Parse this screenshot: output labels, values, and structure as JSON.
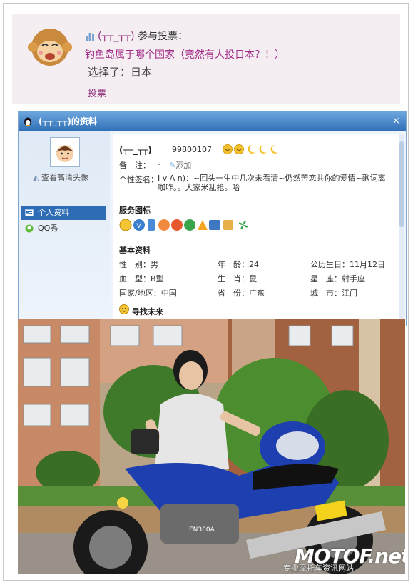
{
  "vote": {
    "nickname": "(┬┬_┬┬)",
    "action": "参与投票：",
    "topic": "钓鱼岛属于哪个国家（竟然有人投日本？！）",
    "choice": "选择了：日本",
    "vote_link": "投票"
  },
  "window": {
    "title": "(┬┬_┬┬)的资料",
    "controls": [
      "—",
      "×"
    ]
  },
  "sidebar": {
    "hd_avatar_link": "查看高清头像",
    "items": [
      {
        "label": "个人资料",
        "icon": "profile-card-icon",
        "active": true
      },
      {
        "label": "QQ秀",
        "icon": "qq-show-icon",
        "active": false
      }
    ]
  },
  "profile": {
    "nickname": "(┬┬_┬┬)",
    "qq_number": "99800107",
    "level_icons": [
      "sun-icon",
      "sun-icon",
      "moon-icon",
      "moon-icon",
      "moon-icon"
    ],
    "note_label": "备　注：",
    "note_value": "-",
    "note_add": "添加",
    "signature_label": "个性签名：",
    "signature_value": "I v A n)：~回头一生中几次未看清~仍然苦恋共你的爱情~歌词离咖咋。。大家米乱抢。哈",
    "service_title": "服务图标",
    "service_icons": [
      "qq-member-icon",
      "qq-vip-icon",
      "mobile-icon",
      "qq-pet-icon",
      "qq-game-icon",
      "qq-music-icon",
      "qzone-icon",
      "qq-photo-icon",
      "qq-mail-icon",
      "clover-icon"
    ],
    "basic_title": "基本资料",
    "basic": [
      {
        "label": "性　别：",
        "value": "男"
      },
      {
        "label": "年　龄：",
        "value": "24"
      },
      {
        "label": "公历生日：",
        "value": "11月12日"
      },
      {
        "label": "血　型：",
        "value": "B型"
      },
      {
        "label": "生　肖：",
        "value": "鼠"
      },
      {
        "label": "星　座：",
        "value": "射手座"
      },
      {
        "label": "国家/地区：",
        "value": "中国"
      },
      {
        "label": "省　份：",
        "value": "广东"
      },
      {
        "label": "城　市：",
        "value": "江门"
      }
    ],
    "find_title": "寻找未来"
  },
  "photo": {
    "plate_text": "EN300A",
    "watermark": "MOTOF.net",
    "watermark_sub": "专业摩托车资讯网站"
  },
  "colors": {
    "card_bg": "#f4eef3",
    "nick": "#8e2e7c",
    "topic": "#a22a86",
    "titlebar": "#2f6fb6",
    "bike_blue": "#1d3fb0"
  }
}
